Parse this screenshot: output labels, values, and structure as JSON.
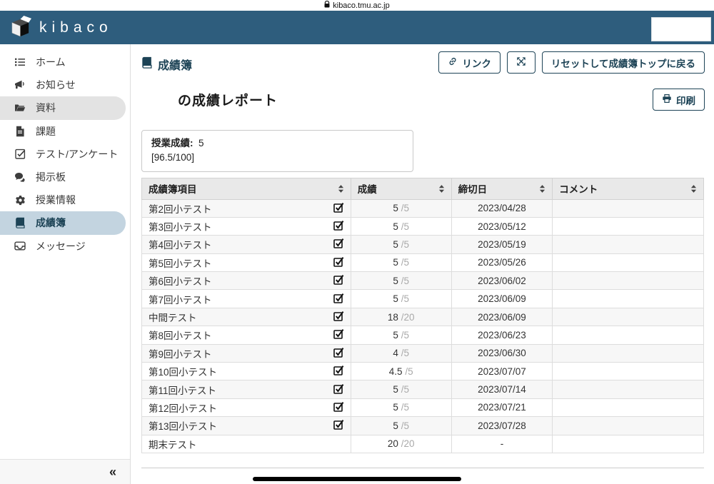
{
  "browser": {
    "url": "kibaco.tmu.ac.jp"
  },
  "header": {
    "logo_text": "kibaco"
  },
  "sidebar": {
    "items": [
      {
        "label": "ホーム"
      },
      {
        "label": "お知らせ"
      },
      {
        "label": "資料"
      },
      {
        "label": "課題"
      },
      {
        "label": "テスト/アンケート"
      },
      {
        "label": "掲示板"
      },
      {
        "label": "授業情報"
      },
      {
        "label": "成績簿"
      },
      {
        "label": "メッセージ"
      }
    ],
    "collapse_label": "«"
  },
  "main": {
    "page_title": "成績簿",
    "toolbar": {
      "link_label": "リンク",
      "reset_label": "リセットして成績簿トップに戻る"
    },
    "report_title": "の成績レポート",
    "print_label": "印刷",
    "summary": {
      "label": "授業成績:",
      "value": "5",
      "detail": "[96.5/100]"
    },
    "table": {
      "columns": [
        "成績簿項目",
        "成績",
        "締切日",
        "コメント"
      ],
      "rows": [
        {
          "item": "第2回小テスト",
          "checked": true,
          "score": "5",
          "max": "/5",
          "due": "2023/04/28",
          "comment": ""
        },
        {
          "item": "第3回小テスト",
          "checked": true,
          "score": "5",
          "max": "/5",
          "due": "2023/05/12",
          "comment": ""
        },
        {
          "item": "第4回小テスト",
          "checked": true,
          "score": "5",
          "max": "/5",
          "due": "2023/05/19",
          "comment": ""
        },
        {
          "item": "第5回小テスト",
          "checked": true,
          "score": "5",
          "max": "/5",
          "due": "2023/05/26",
          "comment": ""
        },
        {
          "item": "第6回小テスト",
          "checked": true,
          "score": "5",
          "max": "/5",
          "due": "2023/06/02",
          "comment": ""
        },
        {
          "item": "第7回小テスト",
          "checked": true,
          "score": "5",
          "max": "/5",
          "due": "2023/06/09",
          "comment": ""
        },
        {
          "item": "中間テスト",
          "checked": true,
          "score": "18",
          "max": "/20",
          "due": "2023/06/09",
          "comment": ""
        },
        {
          "item": "第8回小テスト",
          "checked": true,
          "score": "5",
          "max": "/5",
          "due": "2023/06/23",
          "comment": ""
        },
        {
          "item": "第9回小テスト",
          "checked": true,
          "score": "4",
          "max": "/5",
          "due": "2023/06/30",
          "comment": ""
        },
        {
          "item": "第10回小テスト",
          "checked": true,
          "score": "4.5",
          "max": "/5",
          "due": "2023/07/07",
          "comment": ""
        },
        {
          "item": "第11回小テスト",
          "checked": true,
          "score": "5",
          "max": "/5",
          "due": "2023/07/14",
          "comment": ""
        },
        {
          "item": "第12回小テスト",
          "checked": true,
          "score": "5",
          "max": "/5",
          "due": "2023/07/21",
          "comment": ""
        },
        {
          "item": "第13回小テスト",
          "checked": true,
          "score": "5",
          "max": "/5",
          "due": "2023/07/28",
          "comment": ""
        },
        {
          "item": "期末テスト",
          "checked": false,
          "score": "20",
          "max": "/20",
          "due": "-",
          "comment": ""
        }
      ]
    }
  },
  "colors": {
    "header_blue": "#2e5d7d",
    "accent_navy": "#1d4356",
    "active_item_blue": "#c3d4e0",
    "hover_item_gray": "#e3e3e3",
    "table_header_gray": "#e9e9e9",
    "stripe_gray": "#f7f7f7"
  }
}
